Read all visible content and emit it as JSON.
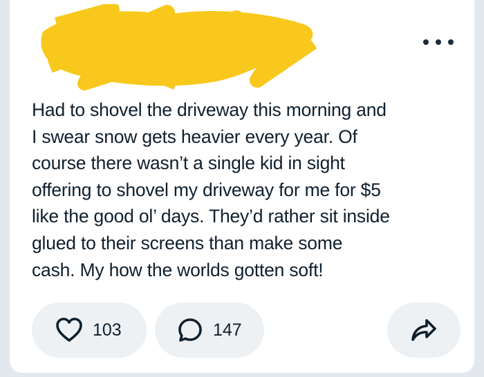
{
  "post": {
    "author_redacted": true,
    "text": "Had to shovel the driveway this morning and\nI swear snow gets heavier every year. Of\ncourse there wasn’t a single kid in sight\noffering to shovel my driveway for me for $5\nlike the good ol’ days. They’d rather sit inside\nglued to their screens than make some\ncash. My how the worlds gotten soft!"
  },
  "actions": {
    "like_count": "103",
    "reply_count": "147"
  },
  "icons": {
    "more": "more-options-icon",
    "like": "heart-icon",
    "reply": "comment-bubble-icon",
    "share": "share-arrow-icon"
  },
  "colors": {
    "redaction": "#f8c81c",
    "text": "#0f1f2d",
    "pill": "#edf1f4"
  }
}
